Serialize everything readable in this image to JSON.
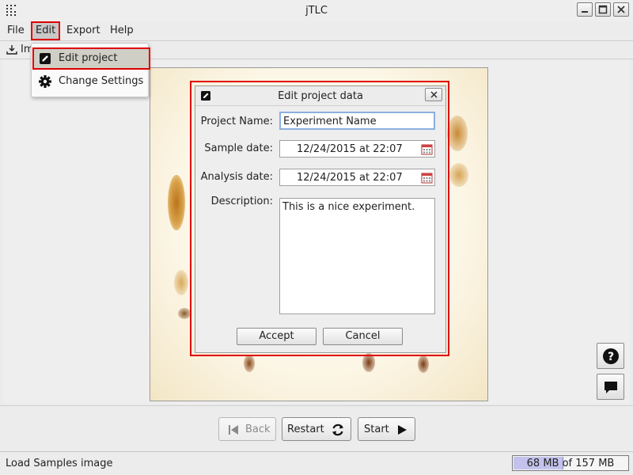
{
  "window": {
    "title": "jTLC",
    "icons": {
      "app": "dot-grid-icon",
      "minimize": "minimize-icon",
      "maximize": "maximize-icon",
      "close": "close-icon"
    }
  },
  "menubar": {
    "items": [
      {
        "label": "File"
      },
      {
        "label": "Edit"
      },
      {
        "label": "Export"
      },
      {
        "label": "Help"
      }
    ]
  },
  "toolbar": {
    "partial_label": "Im"
  },
  "edit_menu": {
    "items": [
      {
        "label": "Edit project",
        "icon": "edit-document-icon",
        "selected": true
      },
      {
        "label": "Change Settings",
        "icon": "gear-icon",
        "selected": false
      }
    ]
  },
  "dialog": {
    "title": "Edit project data",
    "fields": {
      "project_name": {
        "label": "Project Name:",
        "value": "Experiment Name"
      },
      "sample_date": {
        "label": "Sample date:",
        "value": "12/24/2015 at 22:07"
      },
      "analysis_date": {
        "label": "Analysis date:",
        "value": "12/24/2015 at 22:07"
      },
      "description": {
        "label": "Description:",
        "value": "This is a nice experiment."
      }
    },
    "buttons": {
      "accept": "Accept",
      "cancel": "Cancel"
    }
  },
  "navigation": {
    "back": "Back",
    "restart": "Restart",
    "start": "Start"
  },
  "status": {
    "text": "Load Samples image",
    "memory_used": "68 MB",
    "memory_total_text": "of 157 MB",
    "memory_fraction": 0.433
  },
  "colors": {
    "highlight": "#e00000",
    "memory_fill": "#c4c2ec",
    "focus_border": "#8ab0dc"
  }
}
